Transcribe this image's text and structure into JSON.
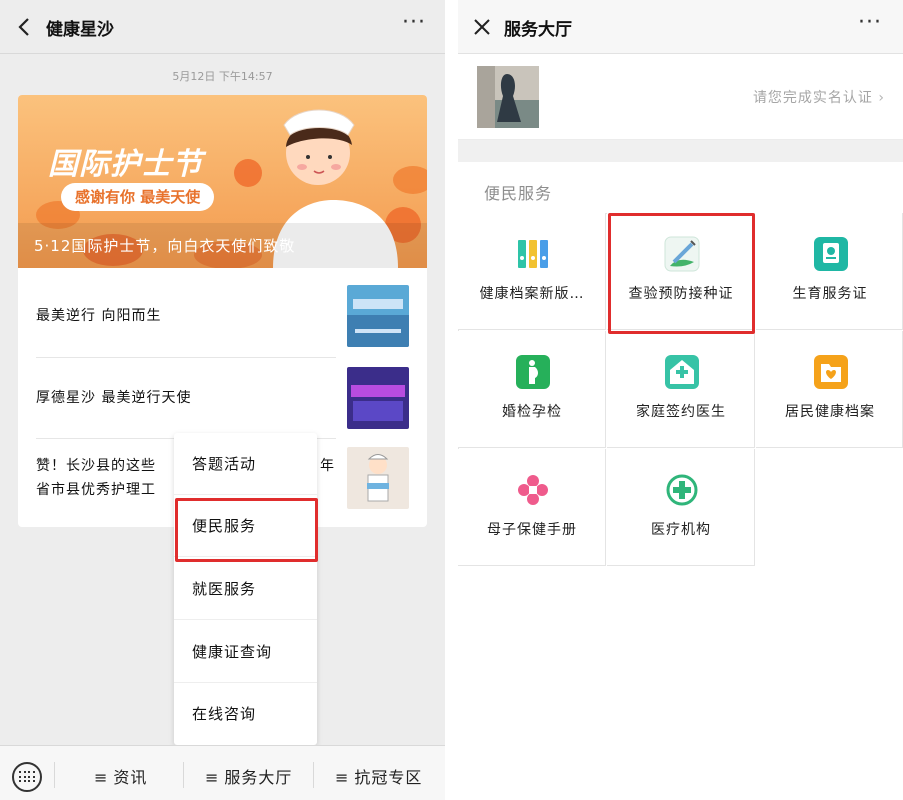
{
  "left": {
    "title": "健康星沙",
    "timestamp": "5月12日 下午14:57",
    "banner": {
      "title": "国际护士节",
      "pill": "感谢有你 最美天使",
      "caption": "5·12国际护士节，向白衣天使们致敬"
    },
    "articles": [
      {
        "text": "最美逆行 向阳而生"
      },
      {
        "text": "厚德星沙 最美逆行天使"
      },
      {
        "line1": "赞！长沙县的这些",
        "line1_tail": "年",
        "line2": "省市县优秀护理工"
      }
    ],
    "menu": [
      "答题活动",
      "便民服务",
      "就医服务",
      "健康证查询",
      "在线咨询"
    ],
    "tabs": [
      "资讯",
      "服务大厅",
      "抗冠专区"
    ]
  },
  "right": {
    "title": "服务大厅",
    "verify_text": "请您完成实名认证",
    "section_title": "便民服务",
    "services": [
      {
        "label": "健康档案新版…",
        "icon": "folders-icon",
        "color": "#2ec4a8"
      },
      {
        "label": "查验预防接种证",
        "icon": "syringe-icon",
        "color": "#43b36a"
      },
      {
        "label": "生育服务证",
        "icon": "certificate-icon",
        "color": "#1fb7a4"
      },
      {
        "label": "婚检孕检",
        "icon": "pregnant-icon",
        "color": "#26b05a"
      },
      {
        "label": "家庭签约医生",
        "icon": "family-doctor-icon",
        "color": "#37c3a6"
      },
      {
        "label": "居民健康档案",
        "icon": "health-record-icon",
        "color": "#f5a21a"
      },
      {
        "label": "母子保健手册",
        "icon": "mother-child-icon",
        "color": "#ef5b8c"
      },
      {
        "label": "医疗机构",
        "icon": "medical-cross-icon",
        "color": "#2fb57a"
      }
    ]
  },
  "colors": {
    "highlight": "#e02d2d",
    "banner": "#f7a25b"
  }
}
